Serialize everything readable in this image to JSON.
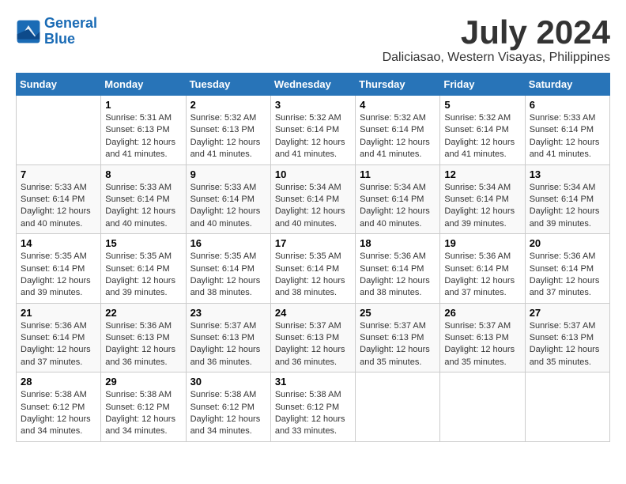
{
  "header": {
    "logo_line1": "General",
    "logo_line2": "Blue",
    "month_year": "July 2024",
    "location": "Daliciasao, Western Visayas, Philippines"
  },
  "weekdays": [
    "Sunday",
    "Monday",
    "Tuesday",
    "Wednesday",
    "Thursday",
    "Friday",
    "Saturday"
  ],
  "weeks": [
    [
      {
        "day": "",
        "sunrise": "",
        "sunset": "",
        "daylight": ""
      },
      {
        "day": "1",
        "sunrise": "Sunrise: 5:31 AM",
        "sunset": "Sunset: 6:13 PM",
        "daylight": "Daylight: 12 hours and 41 minutes."
      },
      {
        "day": "2",
        "sunrise": "Sunrise: 5:32 AM",
        "sunset": "Sunset: 6:13 PM",
        "daylight": "Daylight: 12 hours and 41 minutes."
      },
      {
        "day": "3",
        "sunrise": "Sunrise: 5:32 AM",
        "sunset": "Sunset: 6:14 PM",
        "daylight": "Daylight: 12 hours and 41 minutes."
      },
      {
        "day": "4",
        "sunrise": "Sunrise: 5:32 AM",
        "sunset": "Sunset: 6:14 PM",
        "daylight": "Daylight: 12 hours and 41 minutes."
      },
      {
        "day": "5",
        "sunrise": "Sunrise: 5:32 AM",
        "sunset": "Sunset: 6:14 PM",
        "daylight": "Daylight: 12 hours and 41 minutes."
      },
      {
        "day": "6",
        "sunrise": "Sunrise: 5:33 AM",
        "sunset": "Sunset: 6:14 PM",
        "daylight": "Daylight: 12 hours and 41 minutes."
      }
    ],
    [
      {
        "day": "7",
        "sunrise": "Sunrise: 5:33 AM",
        "sunset": "Sunset: 6:14 PM",
        "daylight": "Daylight: 12 hours and 40 minutes."
      },
      {
        "day": "8",
        "sunrise": "Sunrise: 5:33 AM",
        "sunset": "Sunset: 6:14 PM",
        "daylight": "Daylight: 12 hours and 40 minutes."
      },
      {
        "day": "9",
        "sunrise": "Sunrise: 5:33 AM",
        "sunset": "Sunset: 6:14 PM",
        "daylight": "Daylight: 12 hours and 40 minutes."
      },
      {
        "day": "10",
        "sunrise": "Sunrise: 5:34 AM",
        "sunset": "Sunset: 6:14 PM",
        "daylight": "Daylight: 12 hours and 40 minutes."
      },
      {
        "day": "11",
        "sunrise": "Sunrise: 5:34 AM",
        "sunset": "Sunset: 6:14 PM",
        "daylight": "Daylight: 12 hours and 40 minutes."
      },
      {
        "day": "12",
        "sunrise": "Sunrise: 5:34 AM",
        "sunset": "Sunset: 6:14 PM",
        "daylight": "Daylight: 12 hours and 39 minutes."
      },
      {
        "day": "13",
        "sunrise": "Sunrise: 5:34 AM",
        "sunset": "Sunset: 6:14 PM",
        "daylight": "Daylight: 12 hours and 39 minutes."
      }
    ],
    [
      {
        "day": "14",
        "sunrise": "Sunrise: 5:35 AM",
        "sunset": "Sunset: 6:14 PM",
        "daylight": "Daylight: 12 hours and 39 minutes."
      },
      {
        "day": "15",
        "sunrise": "Sunrise: 5:35 AM",
        "sunset": "Sunset: 6:14 PM",
        "daylight": "Daylight: 12 hours and 39 minutes."
      },
      {
        "day": "16",
        "sunrise": "Sunrise: 5:35 AM",
        "sunset": "Sunset: 6:14 PM",
        "daylight": "Daylight: 12 hours and 38 minutes."
      },
      {
        "day": "17",
        "sunrise": "Sunrise: 5:35 AM",
        "sunset": "Sunset: 6:14 PM",
        "daylight": "Daylight: 12 hours and 38 minutes."
      },
      {
        "day": "18",
        "sunrise": "Sunrise: 5:36 AM",
        "sunset": "Sunset: 6:14 PM",
        "daylight": "Daylight: 12 hours and 38 minutes."
      },
      {
        "day": "19",
        "sunrise": "Sunrise: 5:36 AM",
        "sunset": "Sunset: 6:14 PM",
        "daylight": "Daylight: 12 hours and 37 minutes."
      },
      {
        "day": "20",
        "sunrise": "Sunrise: 5:36 AM",
        "sunset": "Sunset: 6:14 PM",
        "daylight": "Daylight: 12 hours and 37 minutes."
      }
    ],
    [
      {
        "day": "21",
        "sunrise": "Sunrise: 5:36 AM",
        "sunset": "Sunset: 6:14 PM",
        "daylight": "Daylight: 12 hours and 37 minutes."
      },
      {
        "day": "22",
        "sunrise": "Sunrise: 5:36 AM",
        "sunset": "Sunset: 6:13 PM",
        "daylight": "Daylight: 12 hours and 36 minutes."
      },
      {
        "day": "23",
        "sunrise": "Sunrise: 5:37 AM",
        "sunset": "Sunset: 6:13 PM",
        "daylight": "Daylight: 12 hours and 36 minutes."
      },
      {
        "day": "24",
        "sunrise": "Sunrise: 5:37 AM",
        "sunset": "Sunset: 6:13 PM",
        "daylight": "Daylight: 12 hours and 36 minutes."
      },
      {
        "day": "25",
        "sunrise": "Sunrise: 5:37 AM",
        "sunset": "Sunset: 6:13 PM",
        "daylight": "Daylight: 12 hours and 35 minutes."
      },
      {
        "day": "26",
        "sunrise": "Sunrise: 5:37 AM",
        "sunset": "Sunset: 6:13 PM",
        "daylight": "Daylight: 12 hours and 35 minutes."
      },
      {
        "day": "27",
        "sunrise": "Sunrise: 5:37 AM",
        "sunset": "Sunset: 6:13 PM",
        "daylight": "Daylight: 12 hours and 35 minutes."
      }
    ],
    [
      {
        "day": "28",
        "sunrise": "Sunrise: 5:38 AM",
        "sunset": "Sunset: 6:12 PM",
        "daylight": "Daylight: 12 hours and 34 minutes."
      },
      {
        "day": "29",
        "sunrise": "Sunrise: 5:38 AM",
        "sunset": "Sunset: 6:12 PM",
        "daylight": "Daylight: 12 hours and 34 minutes."
      },
      {
        "day": "30",
        "sunrise": "Sunrise: 5:38 AM",
        "sunset": "Sunset: 6:12 PM",
        "daylight": "Daylight: 12 hours and 34 minutes."
      },
      {
        "day": "31",
        "sunrise": "Sunrise: 5:38 AM",
        "sunset": "Sunset: 6:12 PM",
        "daylight": "Daylight: 12 hours and 33 minutes."
      },
      {
        "day": "",
        "sunrise": "",
        "sunset": "",
        "daylight": ""
      },
      {
        "day": "",
        "sunrise": "",
        "sunset": "",
        "daylight": ""
      },
      {
        "day": "",
        "sunrise": "",
        "sunset": "",
        "daylight": ""
      }
    ]
  ]
}
